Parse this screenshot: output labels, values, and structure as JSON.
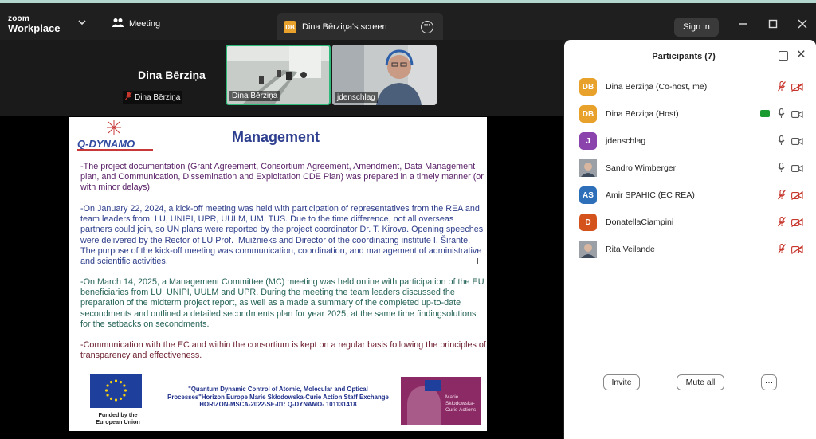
{
  "app": {
    "brand_line1": "zoom",
    "brand_line2": "Workplace"
  },
  "header": {
    "meeting_label": "Meeting",
    "screen_badge": "DB",
    "screen_tab_label": "Dina Bērziņa's screen",
    "sign_in_label": "Sign in"
  },
  "videos": [
    {
      "name": "Dina Bērziņa",
      "big_name": "Dina Bērziņa"
    },
    {
      "name": "Dina Bērziņa"
    },
    {
      "name": "jdenschlag"
    }
  ],
  "slide": {
    "logo_text": "Q-DYNAMO",
    "title": "Management",
    "paragraphs": [
      "-The project documentation (Grant Agreement, Consortium Agreement, Amendment, Data Management plan, and Communication, Dissemination and Exploitation CDE Plan) was prepared in a timely manner (or with minor delays).",
      "-On January 22, 2024, a kick-off meeting was held with participation of representatives from the REA and team leaders from: LU, UNIPI, UPR, UULM, UM, TUS. Due to the time difference, not all overseas partners could join, so UN plans were reported by the project coordinator Dr. T. Kirova. Opening speeches were delivered by the Rector of LU Prof. IMuižnieks and Director of the coordinating institute I. Širante. The purpose of the kick-off meeting was communication, coordination, and management of administrative and scientific activities.",
      "-On March 14, 2025, a Management Committee (MC) meeting was held online with participation of the EU beneficiaries from LU, UNIPI, UULM and UPR. During the meeting the team leaders discussed the preparation of the midterm project report, as well as a made a summary of the completed up-to-date secondments and outlined a detailed secondments plan for year 2025, at the same time findingsolutions for the setbacks on secondments.",
      "-Communication with the EC and within the consortium is kept on a regular basis following the principles of transparency and effectiveness."
    ],
    "eu_caption": "Funded by the European Union",
    "footer_line1": "\"Quantum Dynamic Control of Atomic, Molecular and Optical Processes\"Horizon Europe Marie Skłodowska-Curie Action Staff Exchange",
    "footer_line2": "HORIZON-MSCA-2022-SE-01: Q-DYNAMO- 101131418",
    "msca_text": "Marie Skłodowska-Curie Actions"
  },
  "participants": {
    "title": "Participants (7)",
    "list": [
      {
        "initials": "DB",
        "name": "Dina Bērziņa (Co-host, me)",
        "color": "#e8a12a",
        "mic": "muted",
        "video": "off"
      },
      {
        "initials": "DB",
        "name": "Dina Bērziņa (Host)",
        "color": "#e8a12a",
        "mic": "on",
        "video": "on",
        "sharing": true
      },
      {
        "initials": "J",
        "name": "jdenschlag",
        "color": "#8b44ac",
        "mic": "on",
        "video": "on"
      },
      {
        "initials": "",
        "name": "Sandro Wimberger",
        "photo": true,
        "mic": "on",
        "video": "on"
      },
      {
        "initials": "AS",
        "name": "Amir SPAHIC (EC REA)",
        "color": "#2d6fb8",
        "mic": "muted",
        "video": "off"
      },
      {
        "initials": "D",
        "name": "DonatellaCiampini",
        "color": "#d4531c",
        "mic": "muted",
        "video": "off"
      },
      {
        "initials": "",
        "name": "Rita Veilande",
        "photo": true,
        "mic": "muted",
        "video": "off"
      }
    ],
    "invite_label": "Invite",
    "mute_all_label": "Mute all",
    "more_label": "···"
  },
  "colors": {
    "accent_green": "#2fb97a",
    "mute_red": "#c8372d",
    "panel_bg": "#ffffff"
  }
}
